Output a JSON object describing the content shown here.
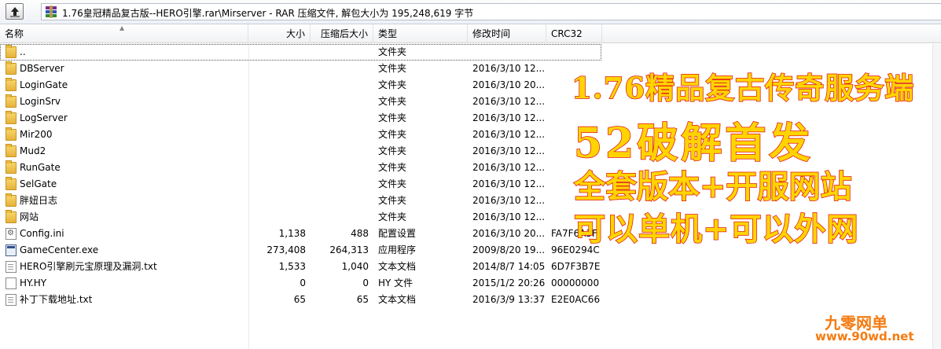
{
  "window": {
    "path": "1.76皇冠精品复古版--HERO引擎.rar\\Mirserver - RAR 压缩文件, 解包大小为 195,248,619 字节"
  },
  "columns": {
    "name": "名称",
    "size": "大小",
    "packed": "压缩后大小",
    "type": "类型",
    "modified": "修改时间",
    "crc": "CRC32"
  },
  "files": [
    {
      "name": "..",
      "size": "",
      "packed": "",
      "type": "文件夹",
      "modified": "",
      "crc": "",
      "icon": "folder-icon"
    },
    {
      "name": "DBServer",
      "size": "",
      "packed": "",
      "type": "文件夹",
      "modified": "2016/3/10 12...",
      "crc": "",
      "icon": "folder-icon"
    },
    {
      "name": "LoginGate",
      "size": "",
      "packed": "",
      "type": "文件夹",
      "modified": "2016/3/10 20...",
      "crc": "",
      "icon": "folder-icon"
    },
    {
      "name": "LoginSrv",
      "size": "",
      "packed": "",
      "type": "文件夹",
      "modified": "2016/3/10 12...",
      "crc": "",
      "icon": "folder-icon"
    },
    {
      "name": "LogServer",
      "size": "",
      "packed": "",
      "type": "文件夹",
      "modified": "2016/3/10 12...",
      "crc": "",
      "icon": "folder-icon"
    },
    {
      "name": "Mir200",
      "size": "",
      "packed": "",
      "type": "文件夹",
      "modified": "2016/3/10 12...",
      "crc": "",
      "icon": "folder-icon"
    },
    {
      "name": "Mud2",
      "size": "",
      "packed": "",
      "type": "文件夹",
      "modified": "2016/3/10 12...",
      "crc": "",
      "icon": "folder-icon"
    },
    {
      "name": "RunGate",
      "size": "",
      "packed": "",
      "type": "文件夹",
      "modified": "2016/3/10 12...",
      "crc": "",
      "icon": "folder-icon"
    },
    {
      "name": "SelGate",
      "size": "",
      "packed": "",
      "type": "文件夹",
      "modified": "2016/3/10 12...",
      "crc": "",
      "icon": "folder-icon"
    },
    {
      "name": "胖妞日志",
      "size": "",
      "packed": "",
      "type": "文件夹",
      "modified": "2016/3/10 12...",
      "crc": "",
      "icon": "folder-icon"
    },
    {
      "name": "网站",
      "size": "",
      "packed": "",
      "type": "文件夹",
      "modified": "2016/3/10 12...",
      "crc": "",
      "icon": "folder-icon"
    },
    {
      "name": "Config.ini",
      "size": "1,138",
      "packed": "488",
      "type": "配置设置",
      "modified": "2016/3/10 20...",
      "crc": "FA7F6A3F",
      "icon": "config-file-icon"
    },
    {
      "name": "GameCenter.exe",
      "size": "273,408",
      "packed": "264,313",
      "type": "应用程序",
      "modified": "2009/8/20 19...",
      "crc": "96E0294C",
      "icon": "exe-file-icon"
    },
    {
      "name": "HERO引擎刷元宝原理及漏洞.txt",
      "size": "1,533",
      "packed": "1,040",
      "type": "文本文档",
      "modified": "2014/8/7 14:05",
      "crc": "6D7F3B7E",
      "icon": "text-file-icon"
    },
    {
      "name": "HY.HY",
      "size": "0",
      "packed": "0",
      "type": "HY 文件",
      "modified": "2015/1/2 20:26",
      "crc": "00000000",
      "icon": "generic-file-icon"
    },
    {
      "name": "补丁下载地址.txt",
      "size": "65",
      "packed": "65",
      "type": "文本文档",
      "modified": "2016/3/9 13:37",
      "crc": "E2E0AC66",
      "icon": "text-file-icon"
    }
  ],
  "promo": {
    "line1": "1.76精品复古传奇服务端",
    "line2": "52破解首发",
    "line3": "全套版本+开服网站",
    "line4": "可以单机+可以外网"
  },
  "watermark": {
    "line1": "九零网单",
    "line2": "www.90wd.net"
  }
}
